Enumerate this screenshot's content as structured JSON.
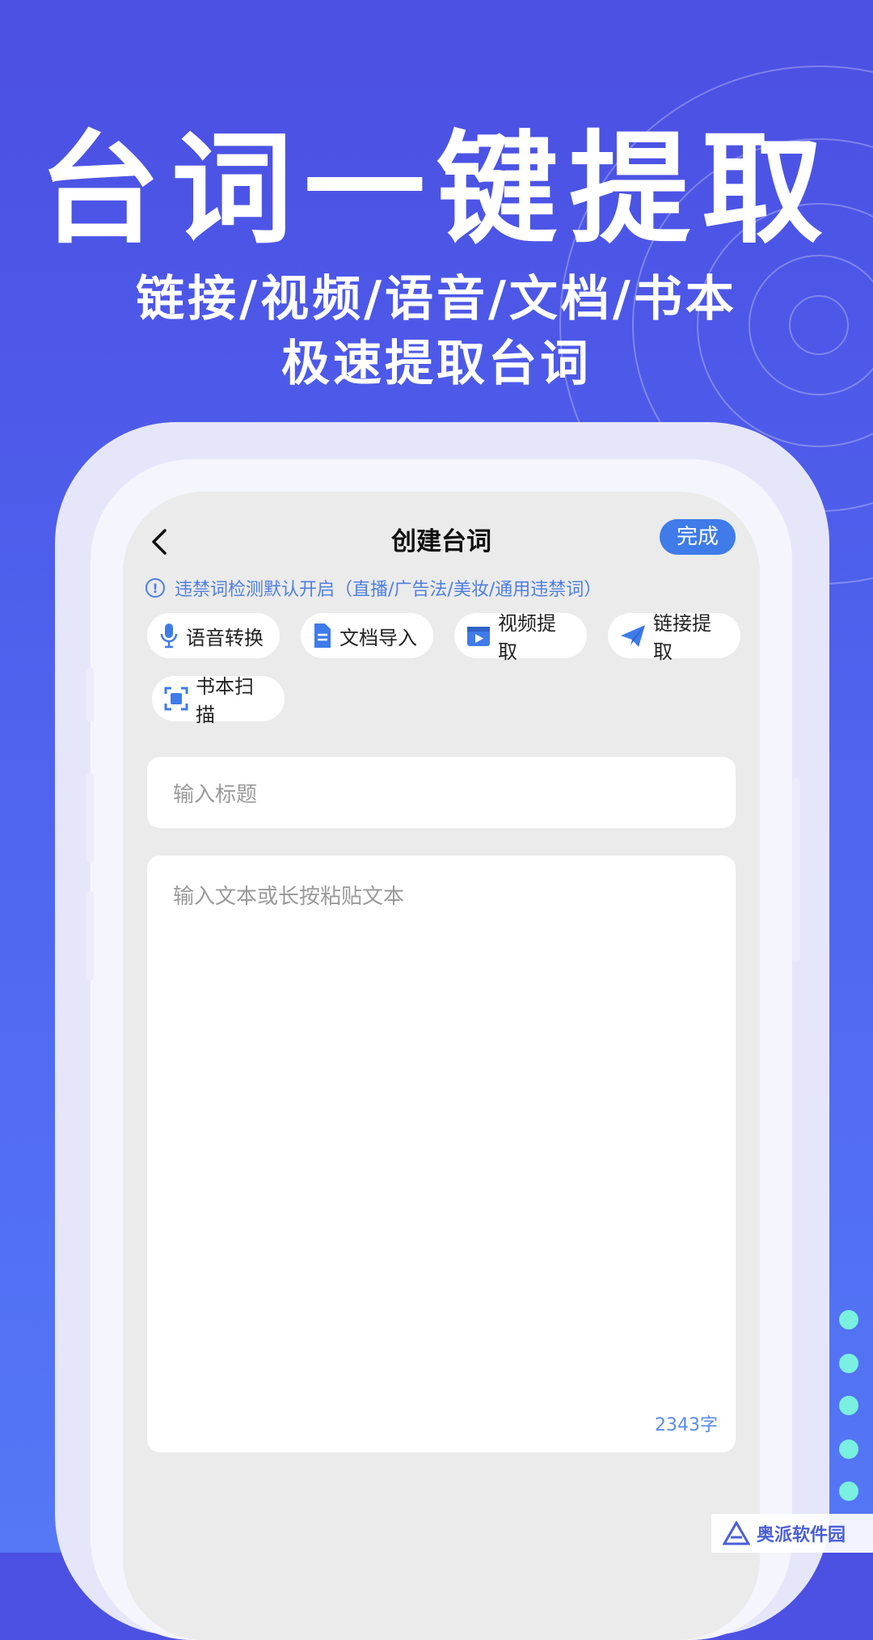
{
  "promo": {
    "headline": "台词一键提取",
    "subline_1": "链接/视频/语音/文档/书本",
    "subline_2": "极速提取台词"
  },
  "nav": {
    "title": "创建台词",
    "done_label": "完成"
  },
  "notice": {
    "text": "违禁词检测默认开启（直播/广告法/美妆/通用违禁词）"
  },
  "tools": [
    {
      "label": "语音转换",
      "icon": "microphone-icon"
    },
    {
      "label": "文档导入",
      "icon": "document-icon"
    },
    {
      "label": "视频提取",
      "icon": "video-icon"
    },
    {
      "label": "链接提取",
      "icon": "send-icon"
    },
    {
      "label": "书本扫描",
      "icon": "scan-icon"
    }
  ],
  "form": {
    "title_placeholder": "输入标题",
    "text_placeholder": "输入文本或长按粘贴文本",
    "char_count": "2343字"
  },
  "watermark": {
    "text": "奥派软件园"
  },
  "colors": {
    "accent": "#3f7be9",
    "background_top": "#4b4fe2",
    "background_bottom": "#5478f6",
    "dots": "#79f0e0"
  }
}
